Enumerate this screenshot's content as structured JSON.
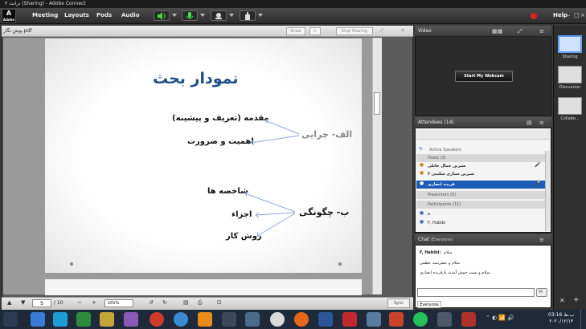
{
  "window": {
    "title": "ترانت ۳ (Sharing) - Adobe Connect"
  },
  "menu": {
    "items": [
      "Meeting",
      "Layouts",
      "Pods",
      "Audio"
    ],
    "help": "Help"
  },
  "share_pod": {
    "filename": "پوش نگار.pdf",
    "draw_label": "Draw",
    "stop_sharing_label": "Stop Sharing",
    "page_current": "5",
    "page_total": "/ 10",
    "zoom": "101%",
    "sync_label": "Sync"
  },
  "slide": {
    "title": "نمودار بحث",
    "section_a": "الف- چرایی",
    "section_a_items": [
      "مقدمه (تعریف و پیشینه)",
      "اهمیت و ضرورت"
    ],
    "section_b": "ب- چگونگی",
    "section_b_items": [
      "شاخصه ها",
      "اجزاء",
      "روش کار"
    ]
  },
  "video_pod": {
    "title": "Video",
    "webcam_button": "Start My Webcam"
  },
  "attendees_pod": {
    "title": "Attendees",
    "count": "(14)",
    "active_speakers": "Active Speakers",
    "hosts_group": "Hosts (3)",
    "hosts": [
      "شیرین جمال خانلی",
      "شیرین سیاری شکیبی ۲",
      "فریده انصاری"
    ],
    "presenters_group": "Presenters (0)",
    "participants_group": "Participants (11)",
    "participants": [
      "e",
      "F, Habibi"
    ]
  },
  "chat_pod": {
    "title": "Chat",
    "scope": "(Everyone)",
    "sender": "F, Habibi:",
    "messages": [
      "سلام",
      "سلام و عصرتمند عظمی",
      "سلام و نسب خوش آمدید بازفریده انصاری"
    ],
    "tab": "Everyone"
  },
  "layouts": [
    "Sharing",
    "Discussion",
    "Collabo..."
  ],
  "taskbar": {
    "time": "03:16 ب.ظ",
    "date": "۲۰۲۰/۱۲/۱۳"
  },
  "colors": {
    "accent": "#1f4e8c",
    "arrow": "#8fa9d9",
    "record": "#e02020"
  }
}
